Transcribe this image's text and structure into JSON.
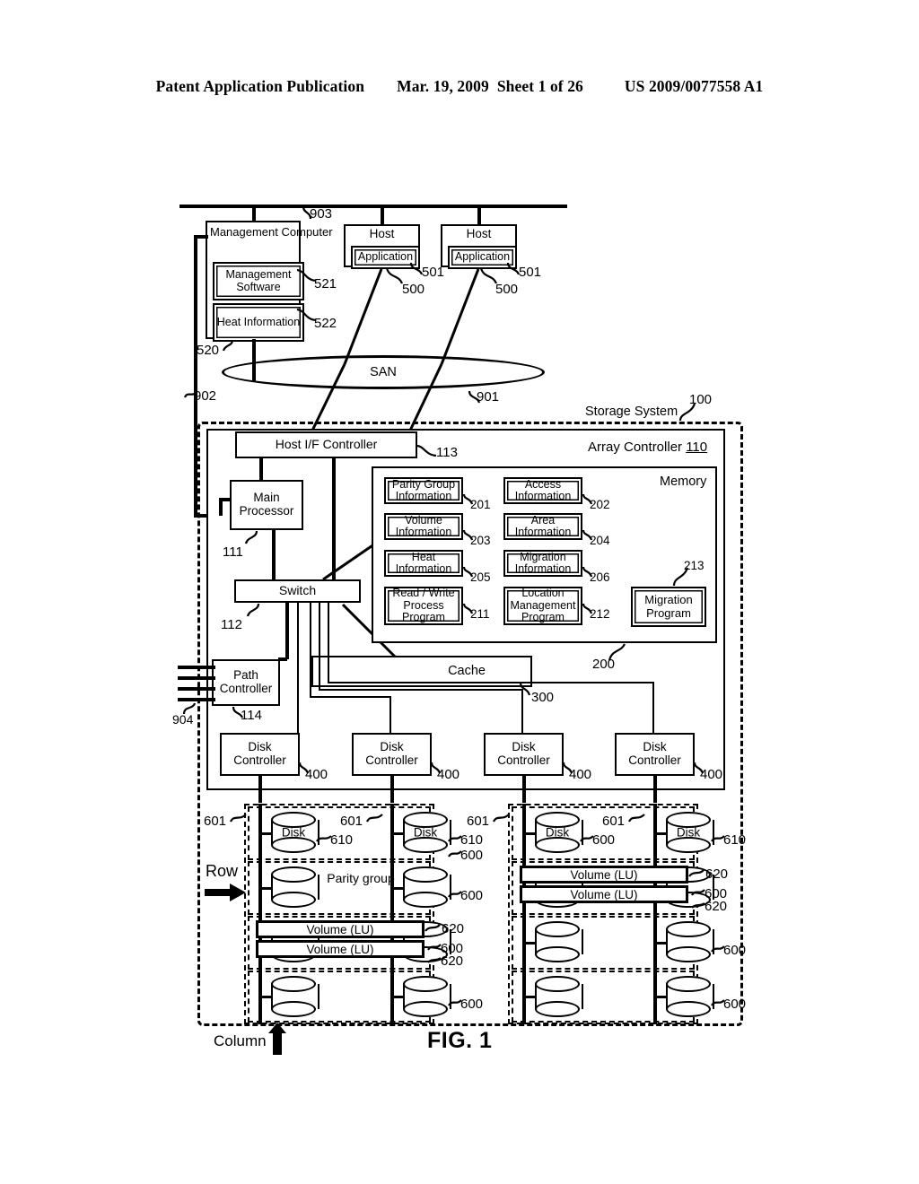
{
  "header": {
    "publication": "Patent Application Publication",
    "date": "Mar. 19, 2009",
    "sheet": "Sheet 1 of 26",
    "docnum": "US 2009/0077558 A1"
  },
  "figure": {
    "caption": "FIG. 1",
    "row_label": "Row",
    "column_label": "Column"
  },
  "network": {
    "bus_ref": "903",
    "mgmt_net_ref": "902",
    "san_label": "SAN",
    "san_ref": "901",
    "path_net_ref": "904"
  },
  "mgmt_computer": {
    "title": "Management Computer",
    "ref": "520",
    "software": {
      "label": "Management Software",
      "ref": "521"
    },
    "heat": {
      "label": "Heat Information",
      "ref": "522"
    }
  },
  "hosts": [
    {
      "title": "Host",
      "ref": "500",
      "app": {
        "label": "Application",
        "ref": "501"
      }
    },
    {
      "title": "Host",
      "ref": "500",
      "app": {
        "label": "Application",
        "ref": "501"
      }
    }
  ],
  "storage": {
    "label": "Storage System",
    "ref": "100",
    "array_controller": {
      "label": "Array Controller",
      "ref": "110"
    },
    "host_if": {
      "label": "Host I/F Controller",
      "ref": "113"
    },
    "main_processor": {
      "label": "Main Processor",
      "ref": "111"
    },
    "switch": {
      "label": "Switch",
      "ref": "112"
    },
    "path_controller": {
      "label": "Path Controller",
      "ref": "114"
    },
    "cache": {
      "label": "Cache",
      "ref": "300"
    },
    "memory": {
      "label": "Memory",
      "ref": "200",
      "items": [
        {
          "label": "Parity Group Information",
          "ref": "201"
        },
        {
          "label": "Access Information",
          "ref": "202"
        },
        {
          "label": "Volume Information",
          "ref": "203"
        },
        {
          "label": "Area Information",
          "ref": "204"
        },
        {
          "label": "Heat Information",
          "ref": "205"
        },
        {
          "label": "Migration Information",
          "ref": "206"
        },
        {
          "label": "Read / Write Process Program",
          "ref": "211"
        },
        {
          "label": "Location Management Program",
          "ref": "212"
        },
        {
          "label": "Migration Program",
          "ref": "213"
        }
      ]
    },
    "disk_controllers": [
      {
        "label": "Disk Controller",
        "ref": "400"
      },
      {
        "label": "Disk Controller",
        "ref": "400"
      },
      {
        "label": "Disk Controller",
        "ref": "400"
      },
      {
        "label": "Disk Controller",
        "ref": "400"
      }
    ]
  },
  "disk_array": {
    "disk_label": "Disk",
    "parity_group_label": "Parity group",
    "volume_label": "Volume (LU)",
    "column_ref": "601",
    "disk_ref": "610",
    "row_ref": "600",
    "volume_ref": "620",
    "labels": {
      "r1c1_disk": "Disk",
      "r1c1_610": "610",
      "r1c2_disk": "Disk",
      "r1c2_610": "610",
      "r1c2_600": "600",
      "r1c3_disk": "Disk",
      "r1c3_600": "600",
      "r1c4_disk": "Disk",
      "r1c4_610": "610",
      "r2_600": "600",
      "r3_620a": "620",
      "r3_600": "600",
      "r3_620b": "620",
      "r4_600": "600",
      "q2r2_620a": "620",
      "q2r2_600": "600",
      "q2r2_620b": "620",
      "q2r3_600": "600",
      "q2r4_600": "600"
    }
  }
}
